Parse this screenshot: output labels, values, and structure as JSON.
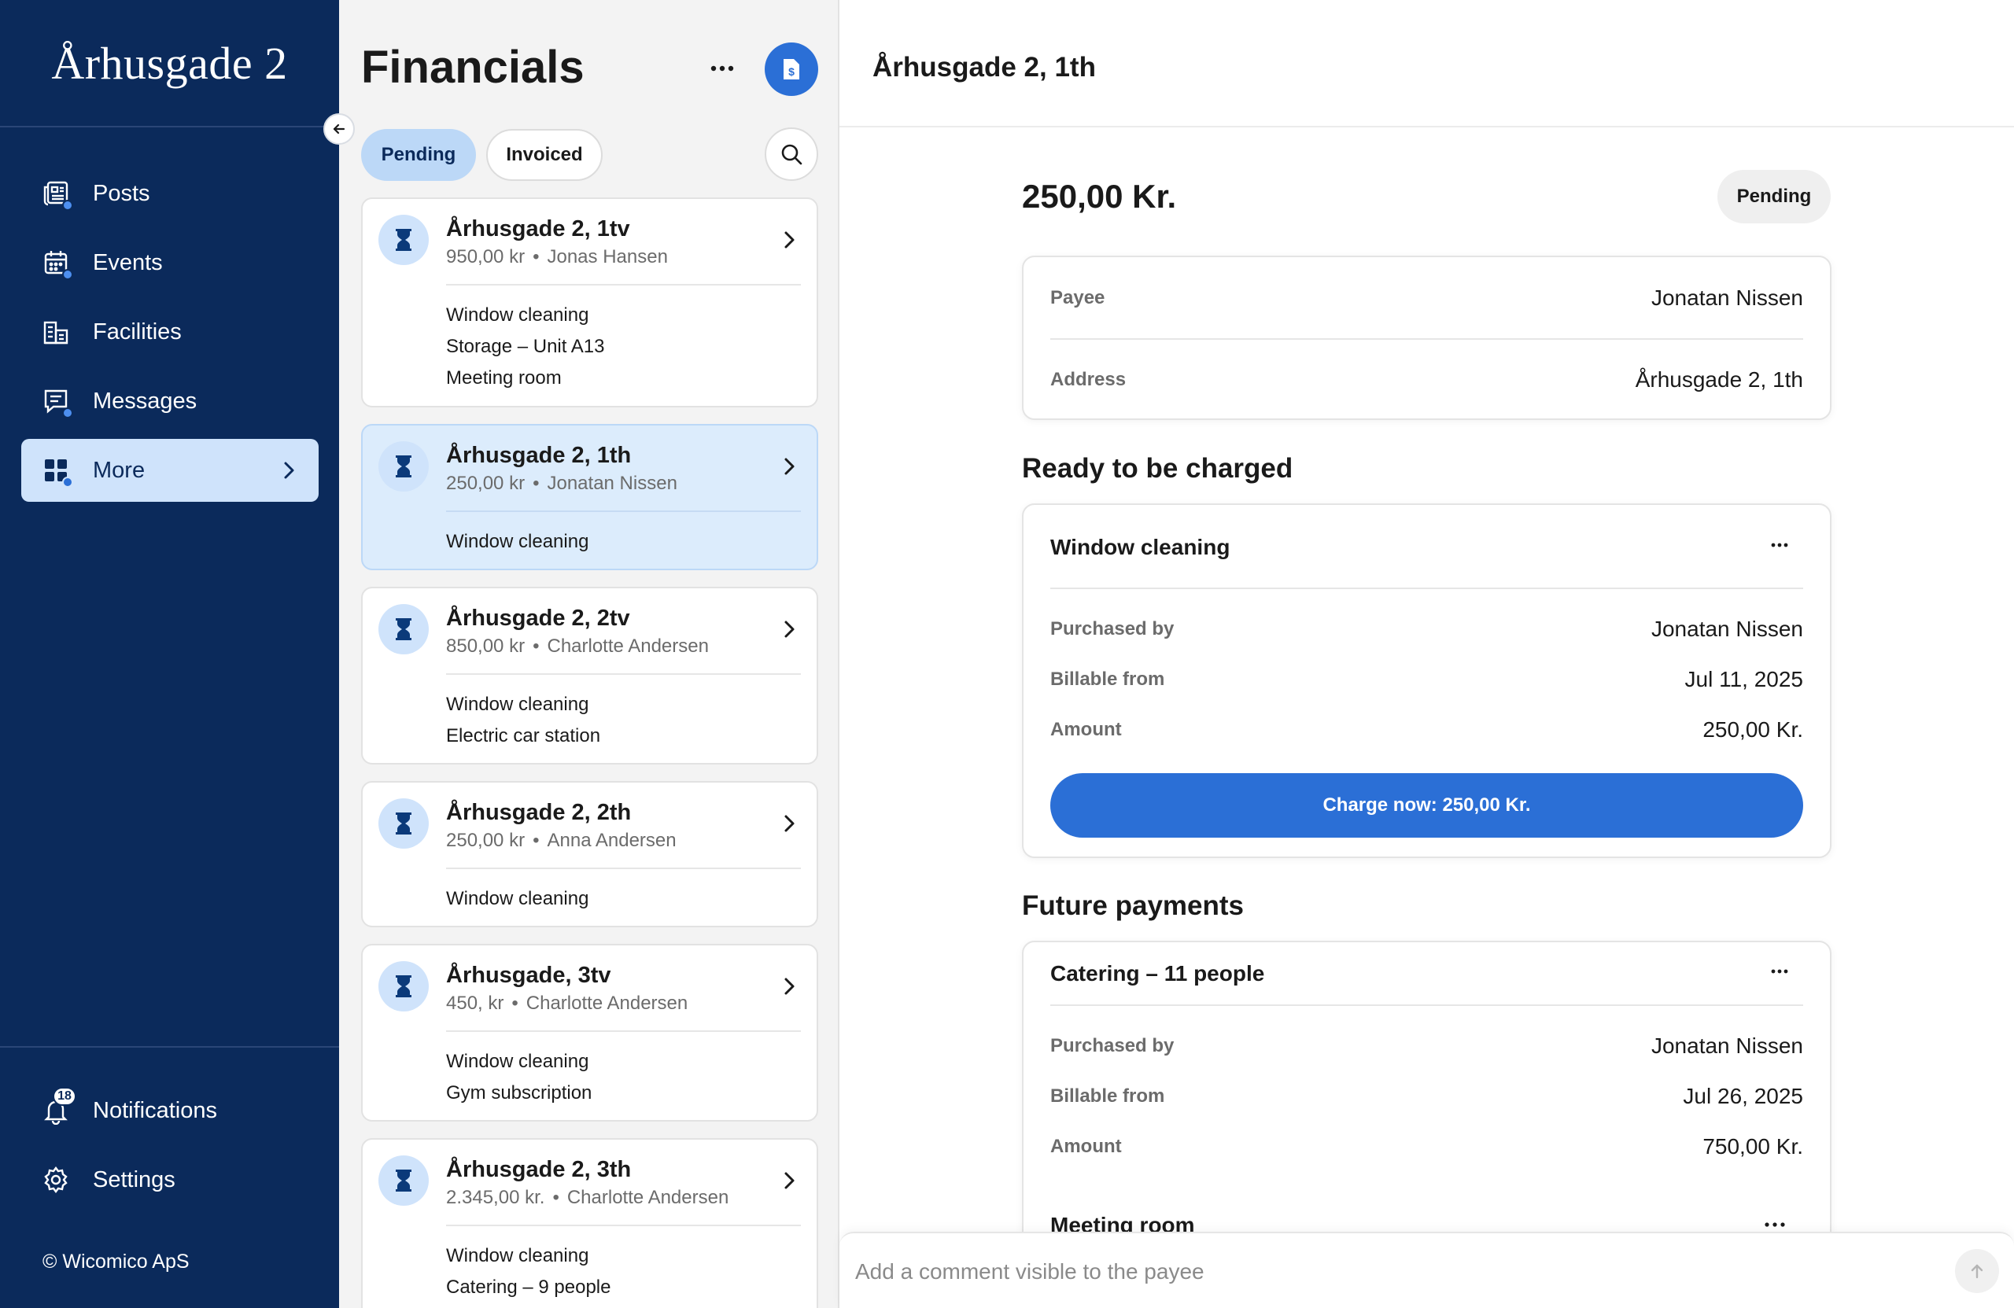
{
  "sidebar": {
    "brand": "Århusgade 2",
    "items": [
      {
        "label": "Posts",
        "icon": "posts-icon"
      },
      {
        "label": "Events",
        "icon": "calendar-icon"
      },
      {
        "label": "Facilities",
        "icon": "facilities-icon"
      },
      {
        "label": "Messages",
        "icon": "messages-icon"
      },
      {
        "label": "More",
        "icon": "grid-icon"
      }
    ],
    "bottom_items": [
      {
        "label": "Notifications",
        "icon": "bell-icon",
        "badge": "18"
      },
      {
        "label": "Settings",
        "icon": "gear-icon"
      }
    ],
    "copyright": "© Wicomico ApS"
  },
  "list": {
    "title": "Financials",
    "tabs": [
      "Pending",
      "Invoiced"
    ],
    "cards": [
      {
        "title": "Århusgade 2, 1tv",
        "amount": "950,00 kr",
        "name": "Jonas Hansen",
        "items": [
          "Window cleaning",
          "Storage – Unit A13",
          "Meeting room"
        ]
      },
      {
        "title": "Århusgade 2, 1th",
        "amount": "250,00 kr",
        "name": "Jonatan Nissen",
        "items": [
          "Window cleaning"
        ]
      },
      {
        "title": "Århusgade 2, 2tv",
        "amount": "850,00 kr",
        "name": "Charlotte Andersen",
        "items": [
          "Window cleaning",
          "Electric car station"
        ]
      },
      {
        "title": "Århusgade 2, 2th",
        "amount": "250,00 kr",
        "name": "Anna Andersen",
        "items": [
          "Window cleaning"
        ]
      },
      {
        "title": "Århusgade, 3tv",
        "amount": "450, kr",
        "name": "Charlotte Andersen",
        "items": [
          "Window cleaning",
          "Gym subscription"
        ]
      },
      {
        "title": "Århusgade 2, 3th",
        "amount": "2.345,00 kr.",
        "name": "Charlotte Andersen",
        "items": [
          "Window cleaning",
          "Catering – 9 people"
        ]
      }
    ],
    "separator": "•"
  },
  "detail": {
    "title": "Århusgade 2, 1th",
    "amount": "250,00 Kr.",
    "status": "Pending",
    "info": {
      "payee_label": "Payee",
      "payee": "Jonatan Nissen",
      "address_label": "Address",
      "address": "Århusgade 2, 1th"
    },
    "ready_title": "Ready to be charged",
    "ready_item": {
      "name": "Window cleaning",
      "purchased_by_label": "Purchased by",
      "purchased_by": "Jonatan Nissen",
      "billable_from_label": "Billable from",
      "billable_from": "Jul 11, 2025",
      "amount_label": "Amount",
      "amount": "250,00 Kr.",
      "charge_button": "Charge now: 250,00 Kr."
    },
    "future_title": "Future payments",
    "future_items": [
      {
        "name": "Catering – 11 people",
        "purchased_by_label": "Purchased by",
        "purchased_by": "Jonatan Nissen",
        "billable_from_label": "Billable from",
        "billable_from": "Jul 26, 2025",
        "amount_label": "Amount",
        "amount": "750,00 Kr."
      },
      {
        "name": "Meeting room"
      }
    ],
    "comment_placeholder": "Add a comment visible to the payee"
  },
  "colors": {
    "sidebar_bg": "#0b2a5b",
    "accent": "#2b6fd6",
    "active_tab": "#bcd8f7",
    "selected_card": "#dcecfc"
  }
}
